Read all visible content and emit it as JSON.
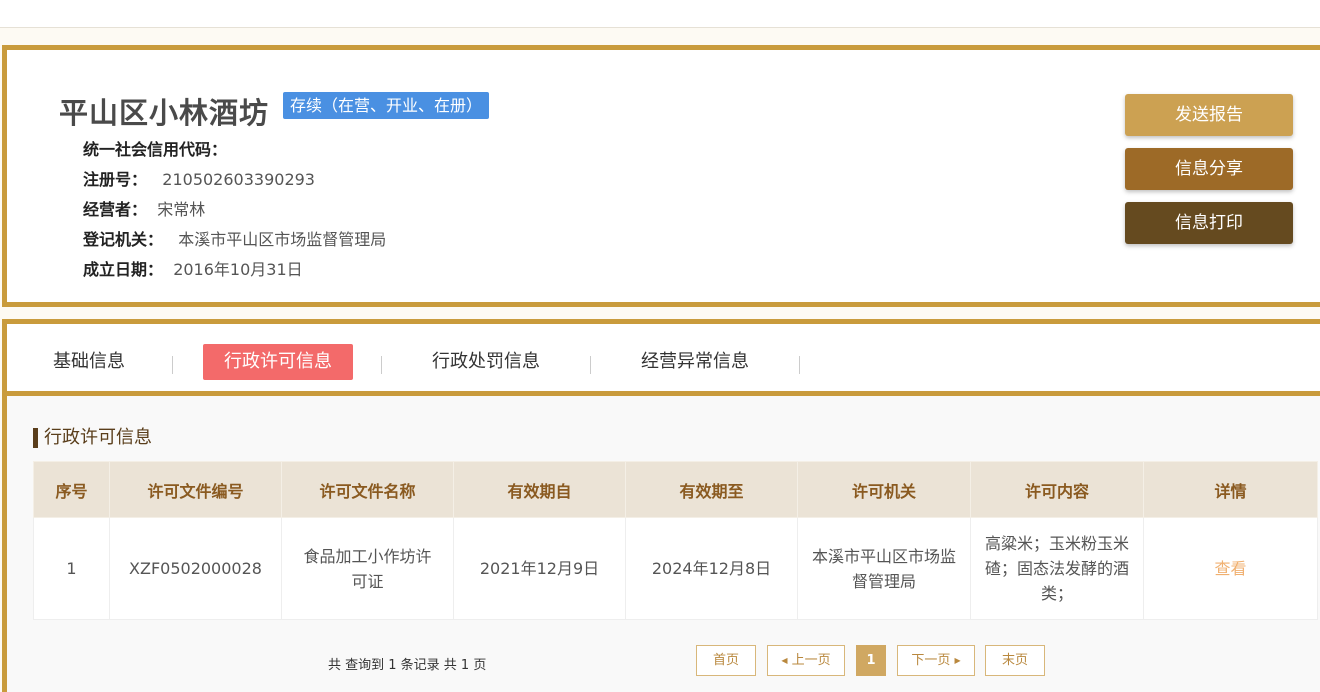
{
  "company": {
    "name": "平山区小林酒坊",
    "status": "存续（在营、开业、在册）",
    "fields": [
      {
        "label": "统一社会信用代码：",
        "value": ""
      },
      {
        "label": "注册号：",
        "value": "210502603390293"
      },
      {
        "label": "经营者：",
        "value": "宋常林"
      },
      {
        "label": "登记机关：",
        "value": "本溪市平山区市场监督管理局"
      },
      {
        "label": "成立日期：",
        "value": "2016年10月31日"
      }
    ]
  },
  "actions": {
    "report": "发送报告",
    "share": "信息分享",
    "print": "信息打印"
  },
  "tabs": [
    {
      "label": "基础信息",
      "active": false
    },
    {
      "label": "行政许可信息",
      "active": true
    },
    {
      "label": "行政处罚信息",
      "active": false
    },
    {
      "label": "经营异常信息",
      "active": false
    }
  ],
  "section_title": "行政许可信息",
  "table": {
    "headers": [
      "序号",
      "许可文件编号",
      "许可文件名称",
      "有效期自",
      "有效期至",
      "许可机关",
      "许可内容",
      "详情"
    ],
    "rows": [
      [
        "1",
        "XZF0502000028",
        "食品加工小作坊许可证",
        "2021年12月9日",
        "2024年12月8日",
        "本溪市平山区市场监督管理局",
        "高粱米；玉米粉玉米碴；固态法发酵的酒类；",
        "查看"
      ]
    ]
  },
  "pagination": {
    "summary": "共 查询到 1 条记录 共 1 页",
    "first": "首页",
    "prev": "上一页",
    "current": "1",
    "next": "下一页",
    "last": "末页"
  },
  "colors": {
    "accent": "#c99b3c",
    "active_tab": "#f36a6a",
    "badge": "#4a90e2"
  }
}
